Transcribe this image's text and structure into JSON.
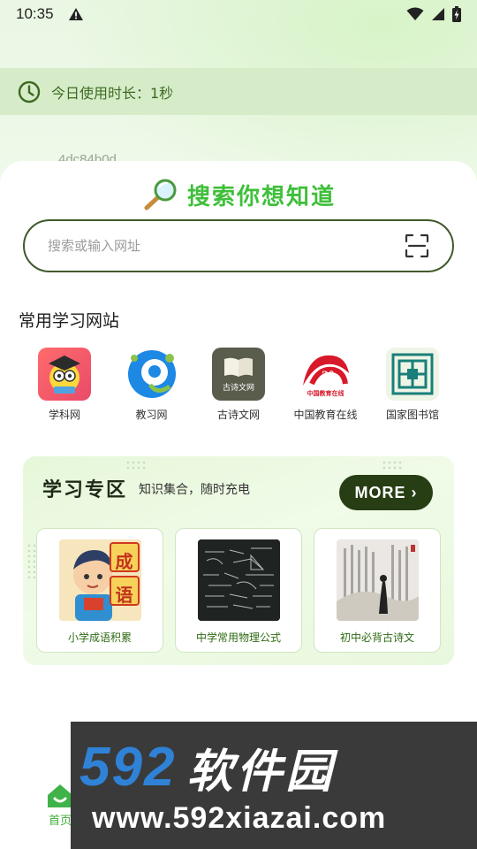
{
  "status_bar": {
    "time": "10:35",
    "warning_icon": "warning-triangle-icon",
    "wifi_icon": "wifi-icon",
    "signal_icon": "signal-icon",
    "battery_icon": "battery-charging-icon"
  },
  "usage": {
    "text": "今日使用时长：1秒",
    "icon": "clock-icon"
  },
  "hash_label": "4dc84b0d",
  "search": {
    "title": "搜索你想知道",
    "placeholder": "搜索或输入网址",
    "icon": "magnifier-icon",
    "scan_icon": "scan-icon"
  },
  "sites_section": {
    "title": "常用学习网站",
    "items": [
      {
        "label": "学科网"
      },
      {
        "label": "教习网"
      },
      {
        "label": "古诗文网",
        "icon_text": "古诗文网"
      },
      {
        "label": "中国教育在线",
        "icon_text": "中国教育在线"
      },
      {
        "label": "国家图书馆"
      }
    ]
  },
  "study": {
    "title": "学习专区",
    "subtitle": "知识集合，随时充电",
    "more_label": "MORE",
    "cards": [
      {
        "label": "小学成语积累",
        "img_text": [
          "成",
          "语"
        ]
      },
      {
        "label": "中学常用物理公式"
      },
      {
        "label": "初中必背古诗文"
      }
    ]
  },
  "bottom_nav": {
    "home_label": "首页"
  },
  "watermark": {
    "number": "592",
    "name": "软件园",
    "url": "www.592xiazai.com"
  },
  "colors": {
    "accent_green": "#3fbf3a",
    "dark_green": "#273d13",
    "usage_bg": "#d6ecc9"
  }
}
